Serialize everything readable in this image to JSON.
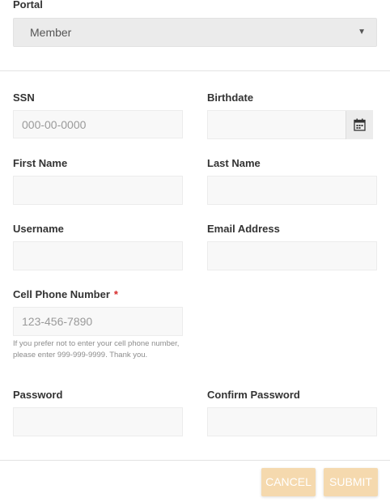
{
  "portal": {
    "label": "Portal",
    "selected": "Member"
  },
  "fields": {
    "ssn": {
      "label": "SSN",
      "placeholder": "000-00-0000",
      "value": ""
    },
    "birthdate": {
      "label": "Birthdate",
      "placeholder": "",
      "value": ""
    },
    "first_name": {
      "label": "First Name",
      "value": ""
    },
    "last_name": {
      "label": "Last Name",
      "value": ""
    },
    "username": {
      "label": "Username",
      "value": ""
    },
    "email": {
      "label": "Email Address",
      "value": ""
    },
    "cell_phone": {
      "label": "Cell Phone Number",
      "required_mark": "*",
      "placeholder": "123-456-7890",
      "value": "",
      "help": "If you prefer not to enter your cell phone number, please enter 999-999-9999. Thank you."
    },
    "password": {
      "label": "Password",
      "value": ""
    },
    "confirm_password": {
      "label": "Confirm Password",
      "value": ""
    }
  },
  "actions": {
    "cancel": "CANCEL",
    "submit": "SUBMIT"
  },
  "icons": {
    "select_arrow": "caret-down-icon",
    "birthdate_button": "calendar-icon"
  },
  "colors": {
    "button_bg": "#f5d9ae",
    "required": "#d62b2b"
  }
}
